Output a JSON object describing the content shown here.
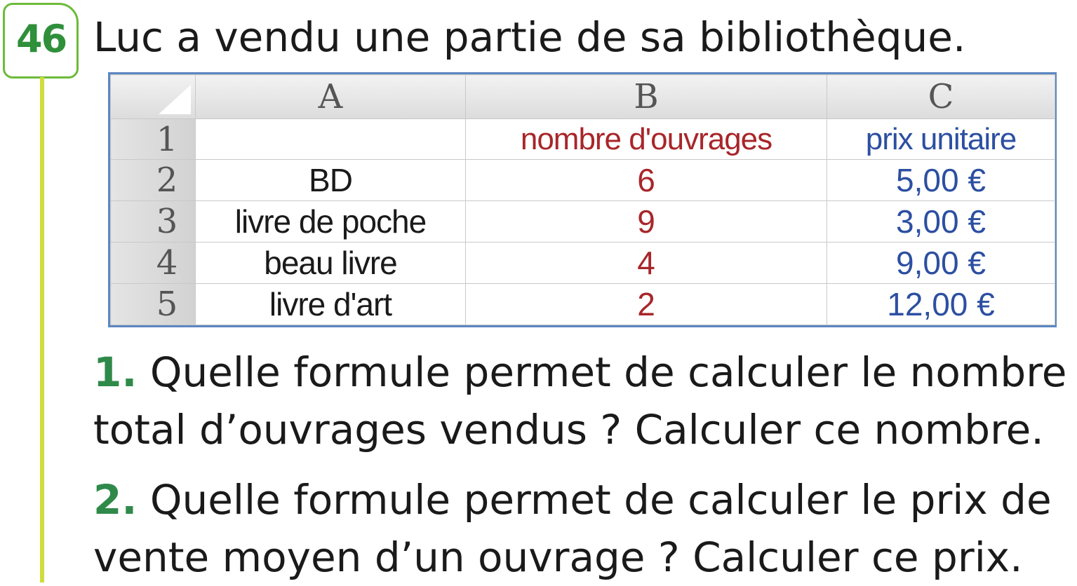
{
  "exercise": {
    "number": "46",
    "title": "Luc a vendu une partie de sa bibliothèque."
  },
  "sheet": {
    "columns": [
      "A",
      "B",
      "C"
    ],
    "header_row": {
      "row_label": "1",
      "a": "",
      "b": "nombre d'ouvrages",
      "c": "prix unitaire"
    },
    "rows": [
      {
        "row_label": "2",
        "a": "BD",
        "b": "6",
        "c": "5,00 €"
      },
      {
        "row_label": "3",
        "a": "livre de poche",
        "b": "9",
        "c": "3,00 €"
      },
      {
        "row_label": "4",
        "a": "beau livre",
        "b": "4",
        "c": "9,00 €"
      },
      {
        "row_label": "5",
        "a": "livre d'art",
        "b": "2",
        "c": "12,00 €"
      }
    ],
    "colors": {
      "count_text": "#a8262a",
      "price_text": "#2c4fa1",
      "border": "#5b86c4"
    }
  },
  "questions": [
    {
      "number": "1.",
      "line1": "Quelle formule permet de calculer le nombre",
      "line2": "total d’ouvrages vendus ? Calculer ce nombre."
    },
    {
      "number": "2.",
      "line1": "Quelle formule permet de calculer le prix de",
      "line2": "vente moyen d’un ouvrage ? Calculer ce prix."
    }
  ],
  "accent_colors": {
    "badge_border": "#6dbb3a",
    "badge_text": "#2f8f3a",
    "margin_line": "#cfdc3c",
    "question_number": "#2f8a4a"
  }
}
